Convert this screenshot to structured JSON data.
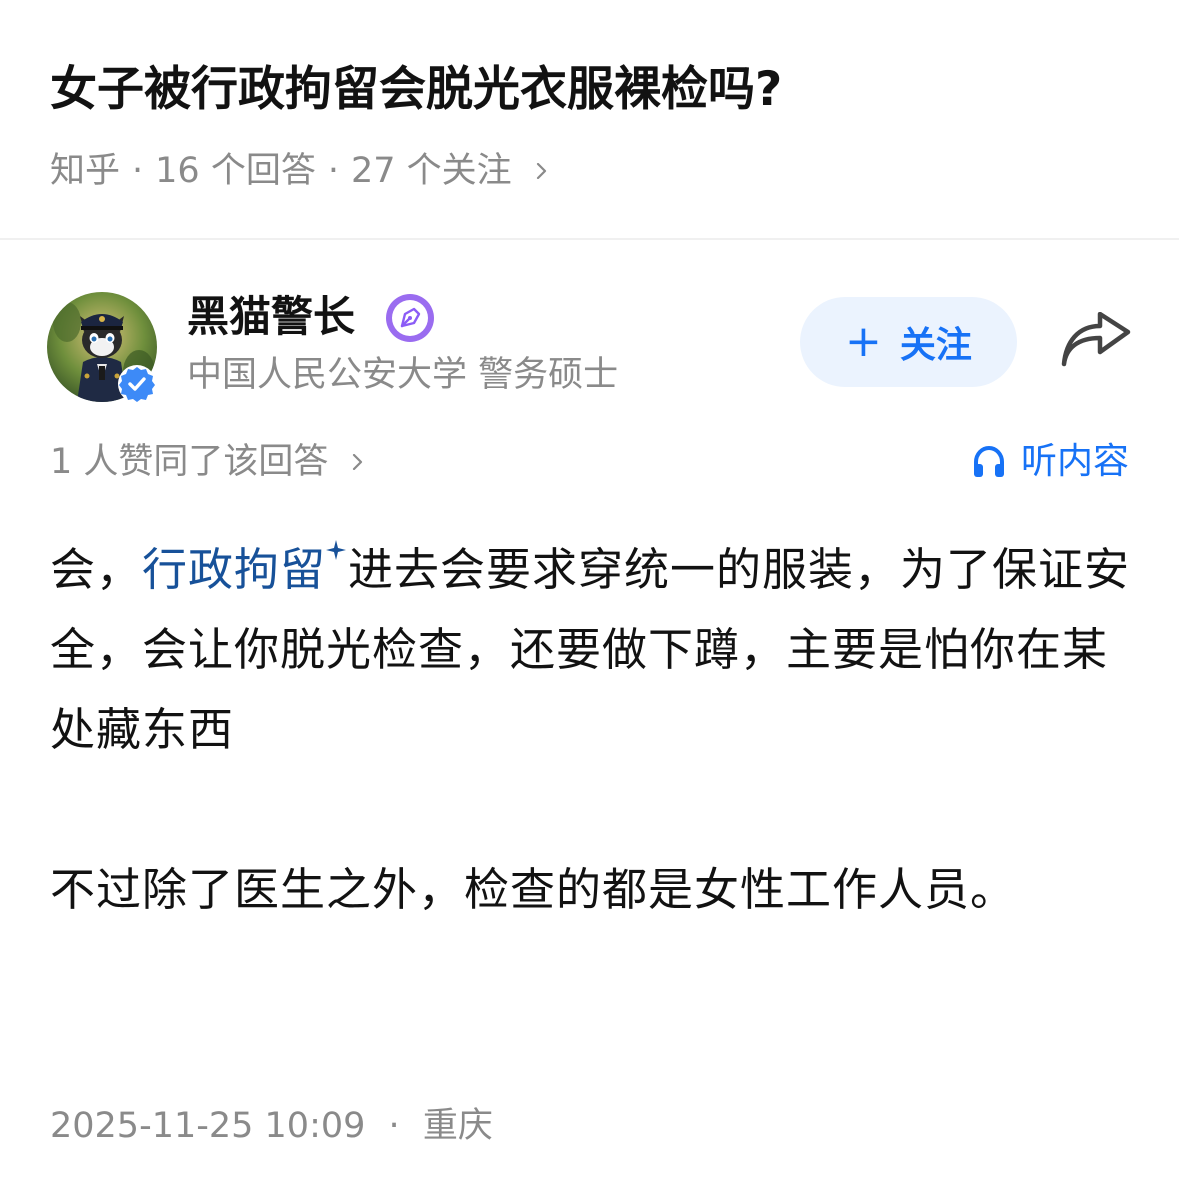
{
  "question": {
    "title": "女子被行政拘留会脱光衣服裸检吗?",
    "source": "知乎",
    "sep": "·",
    "answer_count": "16 个回答",
    "follow_count": "27 个关注"
  },
  "author": {
    "name": "黑猫警长",
    "description": "中国人民公安大学 警务硕士",
    "avatar_icon": "cat-police-avatar",
    "verified_icon": "verified-check-icon",
    "badge_icon": "pen-nib-icon"
  },
  "actions": {
    "follow_plus": "+",
    "follow_label": "关注",
    "share_icon": "share-arrow-icon",
    "listen_label": "听内容",
    "listen_icon": "headphones-icon"
  },
  "votes": {
    "text": "1 人赞同了该回答"
  },
  "answer": {
    "p1_prefix": "会，",
    "p1_keyword": "行政拘留",
    "p1_rest": "进去会要求穿统一的服装，为了保证安全，会让你脱光检查，还要做下蹲，主要是怕你在某处藏东西",
    "p2": "不过除了医生之外，检查的都是女性工作人员。"
  },
  "footer": {
    "datetime": "2025-11-25 10:09",
    "sep": "·",
    "location": "重庆"
  },
  "colors": {
    "brand_blue": "#1772f6",
    "keyword_blue": "#175199",
    "meta_gray": "#8a8a8a",
    "follow_bg": "#ebf3fe",
    "badge_purple": "#8b5cf6"
  }
}
